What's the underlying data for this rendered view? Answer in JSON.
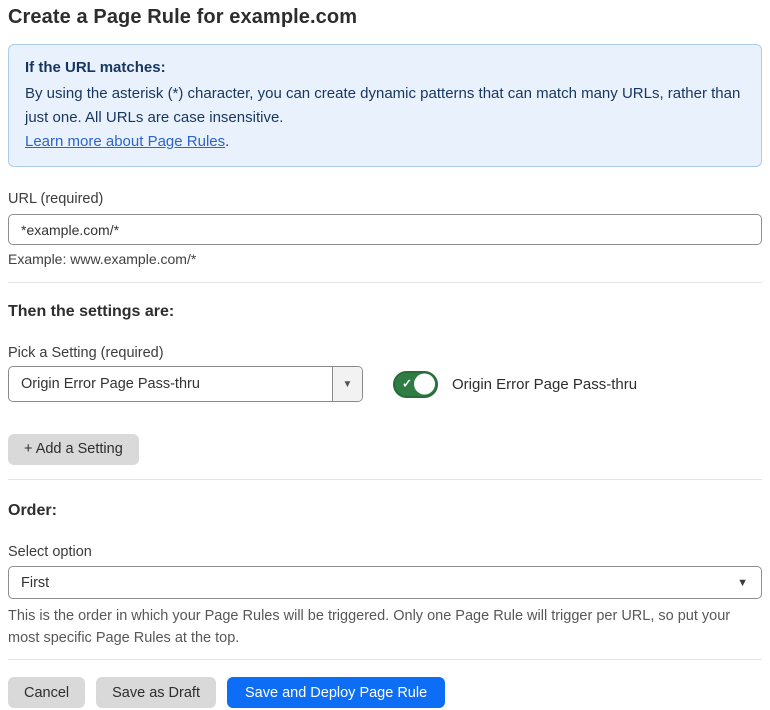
{
  "page": {
    "title": "Create a Page Rule for example.com"
  },
  "info_box": {
    "heading": "If the URL matches:",
    "body": "By using the asterisk (*) character, you can create dynamic patterns that can match many URLs, rather than just one. All URLs are case insensitive.",
    "link_label": "Learn more about Page Rules",
    "link_suffix": "."
  },
  "url_field": {
    "label": "URL (required)",
    "value": "*example.com/*",
    "example": "Example: www.example.com/*"
  },
  "settings": {
    "heading": "Then the settings are:",
    "picker_label": "Pick a Setting (required)",
    "picker_value": "Origin Error Page Pass-thru",
    "picker_arrow_icon": "▼",
    "toggle_state": "on",
    "toggle_check_icon": "✓",
    "toggle_label": "Origin Error Page Pass-thru",
    "add_button_label": "+ Add a Setting"
  },
  "order": {
    "heading": "Order:",
    "select_label": "Select option",
    "select_value": "First",
    "select_arrow_icon": "▼",
    "help_text": "This is the order in which your Page Rules will be triggered. Only one Page Rule will trigger per URL, so put your most specific Page Rules at the top."
  },
  "footer": {
    "cancel_label": "Cancel",
    "save_draft_label": "Save as Draft",
    "save_deploy_label": "Save and Deploy Page Rule"
  },
  "colors": {
    "accent_blue": "#0d6ef5",
    "toggle_green": "#2f7d44",
    "info_background": "#e9f2fc",
    "info_border": "#abccec",
    "info_text": "#17365f",
    "link_blue": "#2c64cc",
    "button_gray": "#d9d9d9"
  }
}
